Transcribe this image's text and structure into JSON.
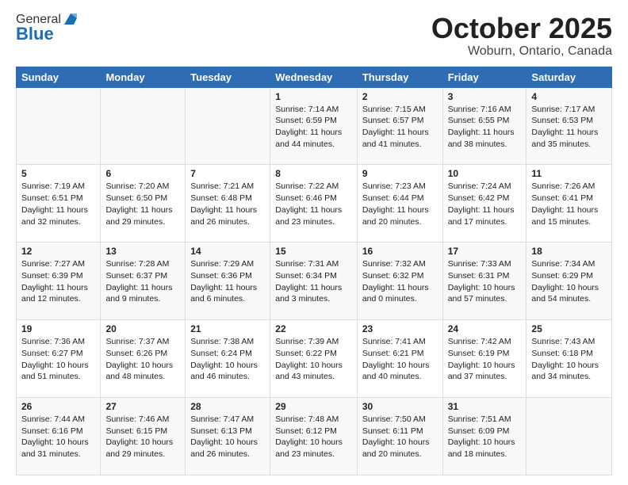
{
  "header": {
    "logo_general": "General",
    "logo_blue": "Blue",
    "title": "October 2025",
    "subtitle": "Woburn, Ontario, Canada"
  },
  "days_of_week": [
    "Sunday",
    "Monday",
    "Tuesday",
    "Wednesday",
    "Thursday",
    "Friday",
    "Saturday"
  ],
  "weeks": [
    [
      {
        "day": "",
        "info": ""
      },
      {
        "day": "",
        "info": ""
      },
      {
        "day": "",
        "info": ""
      },
      {
        "day": "1",
        "info": "Sunrise: 7:14 AM\nSunset: 6:59 PM\nDaylight: 11 hours and 44 minutes."
      },
      {
        "day": "2",
        "info": "Sunrise: 7:15 AM\nSunset: 6:57 PM\nDaylight: 11 hours and 41 minutes."
      },
      {
        "day": "3",
        "info": "Sunrise: 7:16 AM\nSunset: 6:55 PM\nDaylight: 11 hours and 38 minutes."
      },
      {
        "day": "4",
        "info": "Sunrise: 7:17 AM\nSunset: 6:53 PM\nDaylight: 11 hours and 35 minutes."
      }
    ],
    [
      {
        "day": "5",
        "info": "Sunrise: 7:19 AM\nSunset: 6:51 PM\nDaylight: 11 hours and 32 minutes."
      },
      {
        "day": "6",
        "info": "Sunrise: 7:20 AM\nSunset: 6:50 PM\nDaylight: 11 hours and 29 minutes."
      },
      {
        "day": "7",
        "info": "Sunrise: 7:21 AM\nSunset: 6:48 PM\nDaylight: 11 hours and 26 minutes."
      },
      {
        "day": "8",
        "info": "Sunrise: 7:22 AM\nSunset: 6:46 PM\nDaylight: 11 hours and 23 minutes."
      },
      {
        "day": "9",
        "info": "Sunrise: 7:23 AM\nSunset: 6:44 PM\nDaylight: 11 hours and 20 minutes."
      },
      {
        "day": "10",
        "info": "Sunrise: 7:24 AM\nSunset: 6:42 PM\nDaylight: 11 hours and 17 minutes."
      },
      {
        "day": "11",
        "info": "Sunrise: 7:26 AM\nSunset: 6:41 PM\nDaylight: 11 hours and 15 minutes."
      }
    ],
    [
      {
        "day": "12",
        "info": "Sunrise: 7:27 AM\nSunset: 6:39 PM\nDaylight: 11 hours and 12 minutes."
      },
      {
        "day": "13",
        "info": "Sunrise: 7:28 AM\nSunset: 6:37 PM\nDaylight: 11 hours and 9 minutes."
      },
      {
        "day": "14",
        "info": "Sunrise: 7:29 AM\nSunset: 6:36 PM\nDaylight: 11 hours and 6 minutes."
      },
      {
        "day": "15",
        "info": "Sunrise: 7:31 AM\nSunset: 6:34 PM\nDaylight: 11 hours and 3 minutes."
      },
      {
        "day": "16",
        "info": "Sunrise: 7:32 AM\nSunset: 6:32 PM\nDaylight: 11 hours and 0 minutes."
      },
      {
        "day": "17",
        "info": "Sunrise: 7:33 AM\nSunset: 6:31 PM\nDaylight: 10 hours and 57 minutes."
      },
      {
        "day": "18",
        "info": "Sunrise: 7:34 AM\nSunset: 6:29 PM\nDaylight: 10 hours and 54 minutes."
      }
    ],
    [
      {
        "day": "19",
        "info": "Sunrise: 7:36 AM\nSunset: 6:27 PM\nDaylight: 10 hours and 51 minutes."
      },
      {
        "day": "20",
        "info": "Sunrise: 7:37 AM\nSunset: 6:26 PM\nDaylight: 10 hours and 48 minutes."
      },
      {
        "day": "21",
        "info": "Sunrise: 7:38 AM\nSunset: 6:24 PM\nDaylight: 10 hours and 46 minutes."
      },
      {
        "day": "22",
        "info": "Sunrise: 7:39 AM\nSunset: 6:22 PM\nDaylight: 10 hours and 43 minutes."
      },
      {
        "day": "23",
        "info": "Sunrise: 7:41 AM\nSunset: 6:21 PM\nDaylight: 10 hours and 40 minutes."
      },
      {
        "day": "24",
        "info": "Sunrise: 7:42 AM\nSunset: 6:19 PM\nDaylight: 10 hours and 37 minutes."
      },
      {
        "day": "25",
        "info": "Sunrise: 7:43 AM\nSunset: 6:18 PM\nDaylight: 10 hours and 34 minutes."
      }
    ],
    [
      {
        "day": "26",
        "info": "Sunrise: 7:44 AM\nSunset: 6:16 PM\nDaylight: 10 hours and 31 minutes."
      },
      {
        "day": "27",
        "info": "Sunrise: 7:46 AM\nSunset: 6:15 PM\nDaylight: 10 hours and 29 minutes."
      },
      {
        "day": "28",
        "info": "Sunrise: 7:47 AM\nSunset: 6:13 PM\nDaylight: 10 hours and 26 minutes."
      },
      {
        "day": "29",
        "info": "Sunrise: 7:48 AM\nSunset: 6:12 PM\nDaylight: 10 hours and 23 minutes."
      },
      {
        "day": "30",
        "info": "Sunrise: 7:50 AM\nSunset: 6:11 PM\nDaylight: 10 hours and 20 minutes."
      },
      {
        "day": "31",
        "info": "Sunrise: 7:51 AM\nSunset: 6:09 PM\nDaylight: 10 hours and 18 minutes."
      },
      {
        "day": "",
        "info": ""
      }
    ]
  ]
}
